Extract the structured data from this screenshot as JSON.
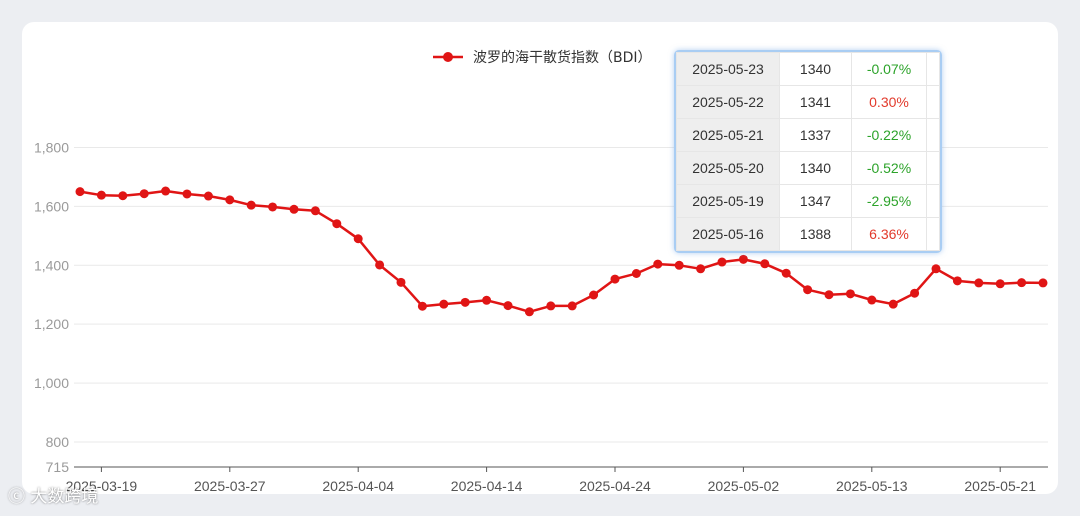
{
  "chart_data": {
    "type": "line",
    "series": [
      {
        "name": "波罗的海干散货指数（BDI）",
        "color": "#e01515",
        "values": [
          1650,
          1638,
          1636,
          1643,
          1652,
          1642,
          1635,
          1622,
          1604,
          1598,
          1590,
          1585,
          1541,
          1490,
          1401,
          1342,
          1261,
          1268,
          1274,
          1281,
          1263,
          1242,
          1262,
          1262,
          1299,
          1353,
          1372,
          1404,
          1400,
          1388,
          1411,
          1420,
          1405,
          1373,
          1317,
          1300,
          1303,
          1282,
          1268,
          1305,
          1388,
          1347,
          1340,
          1337,
          1341,
          1340
        ]
      }
    ],
    "x_tick_labels": [
      "2025-03-19",
      "2025-03-27",
      "2025-04-04",
      "2025-04-14",
      "2025-04-24",
      "2025-05-02",
      "2025-05-13",
      "2025-05-21"
    ],
    "x_tick_indices": [
      1,
      7,
      13,
      19,
      25,
      31,
      37,
      43
    ],
    "y_tick_labels": [
      "715",
      "800",
      "1,000",
      "1,200",
      "1,400",
      "1,600",
      "1,800"
    ],
    "y_tick_values": [
      715,
      800,
      1000,
      1200,
      1400,
      1600,
      1800
    ],
    "ylim": [
      715,
      1900
    ],
    "grid": "horizontal",
    "legend_position": "top-center"
  },
  "tooltip": {
    "rows": [
      {
        "date": "2025-05-23",
        "value": "1340",
        "change": "-0.07%",
        "direction": "down"
      },
      {
        "date": "2025-05-22",
        "value": "1341",
        "change": "0.30%",
        "direction": "up"
      },
      {
        "date": "2025-05-21",
        "value": "1337",
        "change": "-0.22%",
        "direction": "down"
      },
      {
        "date": "2025-05-20",
        "value": "1340",
        "change": "-0.52%",
        "direction": "down"
      },
      {
        "date": "2025-05-19",
        "value": "1347",
        "change": "-2.95%",
        "direction": "down"
      },
      {
        "date": "2025-05-16",
        "value": "1388",
        "change": "6.36%",
        "direction": "up"
      }
    ]
  },
  "watermark": {
    "text": "大数跨境",
    "icon": "brand-logo-icon"
  },
  "colors": {
    "series": "#e01515",
    "up": "#e23a2c",
    "down": "#2ca32a",
    "grid": "#e9e9e9",
    "axis_text": "#9a9a9a"
  }
}
